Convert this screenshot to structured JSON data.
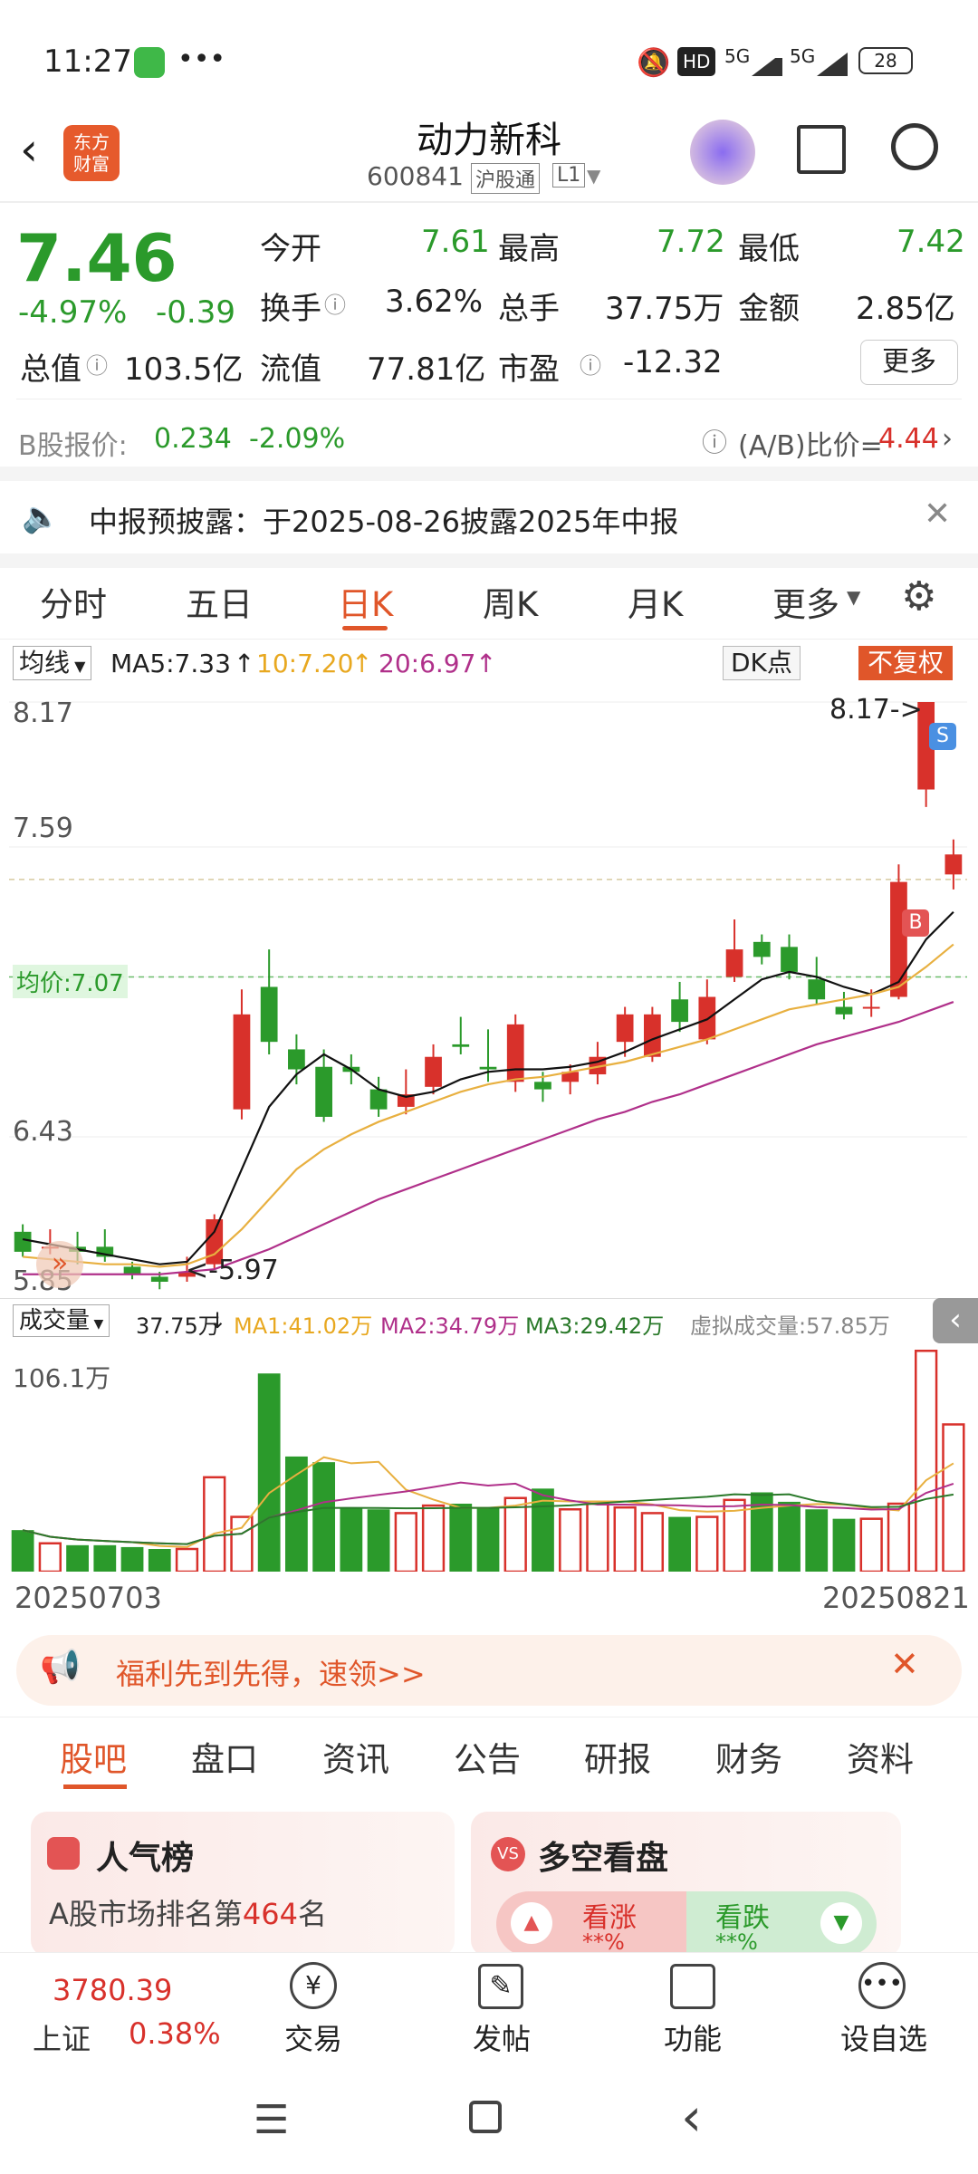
{
  "status": {
    "time": "11:27",
    "battery": "28",
    "net1": "5G",
    "net2": "5G",
    "hd": "HD"
  },
  "header": {
    "brand": "东方\n财富",
    "name": "动力新科",
    "code": "600841",
    "tag1": "沪股通",
    "tag2": "L1"
  },
  "quote": {
    "price": "7.46",
    "pct": "-4.97%",
    "chg": "-0.39",
    "open_l": "今开",
    "open": "7.61",
    "high_l": "最高",
    "high": "7.72",
    "low_l": "最低",
    "low": "7.42",
    "turn_l": "换手",
    "turn": "3.62%",
    "vol_l": "总手",
    "vol": "37.75万",
    "amt_l": "金额",
    "amt": "2.85亿",
    "mcap_l": "总值",
    "mcap": "103.5亿",
    "fcap_l": "流值",
    "fcap": "77.81亿",
    "pe_l": "市盈",
    "pe": "-12.32",
    "more": "更多",
    "b_l": "B股报价:",
    "b_price": "0.234",
    "b_pct": "-2.09%",
    "ab_l": "(A/B)比价=",
    "ab": "4.44"
  },
  "notice": {
    "text": "中报预披露：于2025-08-26披露2025年中报"
  },
  "tabs": [
    "分时",
    "五日",
    "日K",
    "周K",
    "月K",
    "更多"
  ],
  "ma": {
    "label": "均线",
    "ma5": "MA5:7.33",
    "ma10": "10:7.20",
    "ma20": "20:6.97",
    "dk": "DK点",
    "fq": "不复权"
  },
  "chart_data": {
    "type": "candlestick",
    "y_ticks": [
      "8.17",
      "7.59",
      "7.07",
      "6.43",
      "5.85"
    ],
    "y_range": [
      5.85,
      8.17
    ],
    "annotations": {
      "high": "8.17->",
      "low": "<-5.97",
      "avg": "均价:7.07",
      "sell": "S",
      "buy": "B"
    },
    "candles": [
      [
        6.05,
        5.97,
        6.08,
        5.95
      ],
      [
        5.99,
        5.99,
        6.06,
        5.96
      ],
      [
        5.99,
        5.97,
        6.05,
        5.92
      ],
      [
        5.99,
        5.95,
        6.06,
        5.93
      ],
      [
        5.91,
        5.88,
        5.93,
        5.86
      ],
      [
        5.87,
        5.85,
        5.89,
        5.82
      ],
      [
        5.87,
        5.89,
        5.95,
        5.85
      ],
      [
        5.92,
        6.1,
        6.12,
        5.9
      ],
      [
        6.54,
        6.92,
        7.02,
        6.5
      ],
      [
        7.03,
        6.81,
        7.18,
        6.76
      ],
      [
        6.78,
        6.7,
        6.84,
        6.64
      ],
      [
        6.71,
        6.51,
        6.78,
        6.49
      ],
      [
        6.71,
        6.69,
        6.76,
        6.64
      ],
      [
        6.62,
        6.54,
        6.67,
        6.51
      ],
      [
        6.55,
        6.6,
        6.7,
        6.52
      ],
      [
        6.63,
        6.75,
        6.8,
        6.6
      ],
      [
        6.8,
        6.79,
        6.91,
        6.76
      ],
      [
        6.71,
        6.7,
        6.86,
        6.65
      ],
      [
        6.65,
        6.88,
        6.92,
        6.61
      ],
      [
        6.65,
        6.62,
        6.69,
        6.57
      ],
      [
        6.65,
        6.69,
        6.72,
        6.6
      ],
      [
        6.68,
        6.75,
        6.81,
        6.64
      ],
      [
        6.81,
        6.92,
        6.95,
        6.75
      ],
      [
        6.75,
        6.92,
        6.95,
        6.73
      ],
      [
        6.98,
        6.89,
        7.05,
        6.85
      ],
      [
        6.82,
        6.99,
        7.06,
        6.8
      ],
      [
        7.07,
        7.18,
        7.3,
        7.05
      ],
      [
        7.21,
        7.15,
        7.24,
        7.12
      ],
      [
        7.19,
        7.09,
        7.24,
        7.06
      ],
      [
        7.06,
        6.98,
        7.15,
        6.96
      ],
      [
        6.95,
        6.92,
        7.01,
        6.9
      ],
      [
        6.95,
        6.95,
        7.02,
        6.91
      ],
      [
        6.99,
        7.45,
        7.52,
        6.98
      ],
      [
        7.82,
        8.17,
        8.17,
        7.75
      ],
      [
        7.48,
        7.56,
        7.62,
        7.42
      ]
    ],
    "ma_series": {
      "ma5": [
        6.02,
        6.0,
        5.98,
        5.96,
        5.94,
        5.92,
        5.93,
        6.05,
        6.3,
        6.55,
        6.68,
        6.76,
        6.7,
        6.62,
        6.59,
        6.61,
        6.66,
        6.69,
        6.7,
        6.7,
        6.71,
        6.73,
        6.77,
        6.82,
        6.86,
        6.9,
        6.98,
        7.06,
        7.09,
        7.07,
        7.03,
        7.0,
        7.05,
        7.22,
        7.33
      ],
      "ma10": [
        5.95,
        5.94,
        5.93,
        5.92,
        5.92,
        5.91,
        5.92,
        5.96,
        6.06,
        6.18,
        6.3,
        6.38,
        6.44,
        6.49,
        6.53,
        6.57,
        6.61,
        6.64,
        6.66,
        6.67,
        6.69,
        6.71,
        6.73,
        6.76,
        6.79,
        6.82,
        6.86,
        6.9,
        6.94,
        6.96,
        6.98,
        7.0,
        7.03,
        7.11,
        7.2
      ],
      "ma20": [
        5.88,
        5.88,
        5.88,
        5.88,
        5.88,
        5.88,
        5.89,
        5.9,
        5.94,
        5.98,
        6.03,
        6.08,
        6.13,
        6.18,
        6.22,
        6.26,
        6.3,
        6.34,
        6.38,
        6.42,
        6.46,
        6.5,
        6.53,
        6.57,
        6.6,
        6.64,
        6.68,
        6.72,
        6.76,
        6.8,
        6.83,
        6.86,
        6.89,
        6.93,
        6.97
      ]
    }
  },
  "volume": {
    "label": "成交量",
    "value": "37.75万",
    "ma1": "MA1:41.02万",
    "ma2": "MA2:34.79万",
    "ma3": "MA3:29.42万",
    "virt": "虚拟成交量:57.85万",
    "ymax": "106.1万",
    "bars": [
      22,
      15,
      14,
      14,
      13,
      12,
      12,
      50,
      29,
      105,
      61,
      58,
      34,
      33,
      31,
      35,
      36,
      34,
      39,
      44,
      33,
      36,
      34,
      31,
      29,
      29,
      38,
      42,
      37,
      33,
      28,
      28,
      36,
      117,
      78
    ],
    "date_start": "20250703",
    "date_end": "20250821"
  },
  "promo": {
    "text": "福利先到先得，速领>>"
  },
  "bottom_tabs": [
    "股吧",
    "盘口",
    "资讯",
    "公告",
    "研报",
    "财务",
    "资料"
  ],
  "cards": {
    "c1_title": "人气榜",
    "c1_line": "A股市场排名第",
    "c1_rank": "464",
    "c1_suffix": "名",
    "c2_title": "多空看盘",
    "up": "看涨",
    "down": "看跌",
    "mask": "**%"
  },
  "bnav": {
    "index_val": "3780.39",
    "index_name": "上证",
    "index_pct": "0.38%",
    "trade": "交易",
    "post": "发帖",
    "func": "功能",
    "fav": "设自选"
  }
}
